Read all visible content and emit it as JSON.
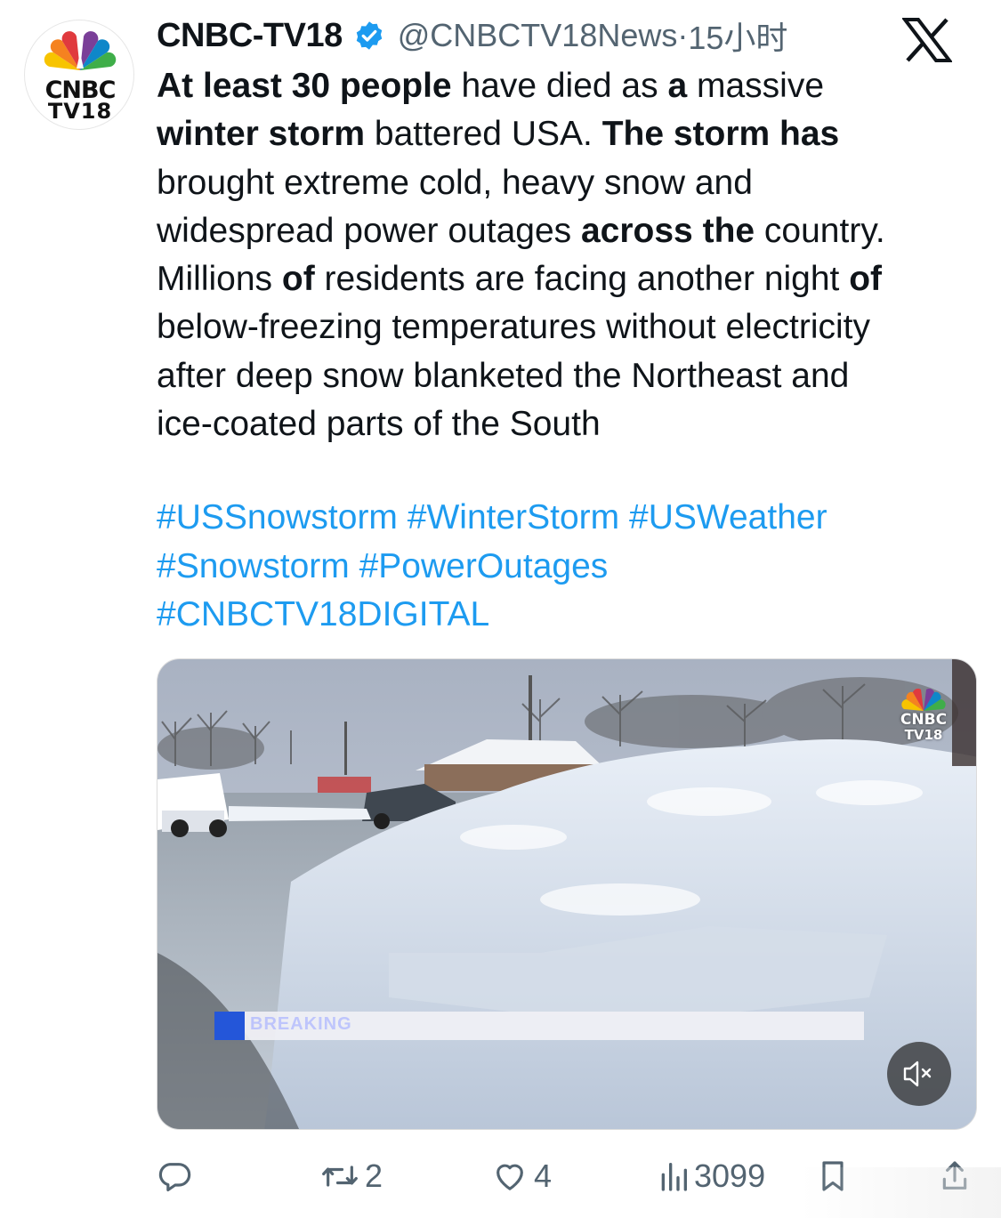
{
  "author": {
    "name": "CNBC-TV18",
    "handle": "@CNBCTV18News",
    "separator": "·",
    "time": "15小时",
    "avatar_text_line1": "CNBC",
    "avatar_text_line2": "TV18",
    "verified_color": "#1d9bf0"
  },
  "platform_icon": "x-logo-icon",
  "tweet": {
    "lines": [
      [
        {
          "b": "At least 30 people"
        },
        {
          "t": " have died as "
        },
        {
          "b": "a"
        },
        {
          "t": " massive"
        }
      ],
      [
        {
          "b": "winter storm"
        },
        {
          "t": " battered USA. "
        },
        {
          "b": "The storm has"
        }
      ],
      [
        {
          "t": "brought extreme cold, heavy snow and"
        }
      ],
      [
        {
          "t": "widespread power outages "
        },
        {
          "b": "across the"
        },
        {
          "t": " country."
        }
      ],
      [
        {
          "t": "Millions "
        },
        {
          "b": "of"
        },
        {
          "t": " residents are facing another night "
        },
        {
          "b": "of"
        }
      ],
      [
        {
          "t": "below-freezing temperatures without electricity"
        }
      ],
      [
        {
          "t": "after deep snow blanketed the Northeast and"
        }
      ],
      [
        {
          "t": "ice-coated parts of the South"
        }
      ]
    ]
  },
  "hashtags": {
    "lines": [
      [
        "#USSnowstorm",
        "#WinterStorm",
        "#USWeather"
      ],
      [
        "#Snowstorm",
        "#PowerOutages"
      ],
      [
        "#CNBCTV18DIGITAL"
      ]
    ]
  },
  "media": {
    "watermark_line1": "CNBC",
    "watermark_line2": "TV18",
    "ticker_text": "BREAKING",
    "progress_fraction": 0.047,
    "mute_icon": "volume-muted-icon"
  },
  "actions": {
    "reply_count": "",
    "retweet_count": "2",
    "like_count": "4",
    "views_count": "3099"
  },
  "colors": {
    "link": "#1d9bf0",
    "muted_text": "#536471",
    "progress_fill": "#2456d9"
  }
}
